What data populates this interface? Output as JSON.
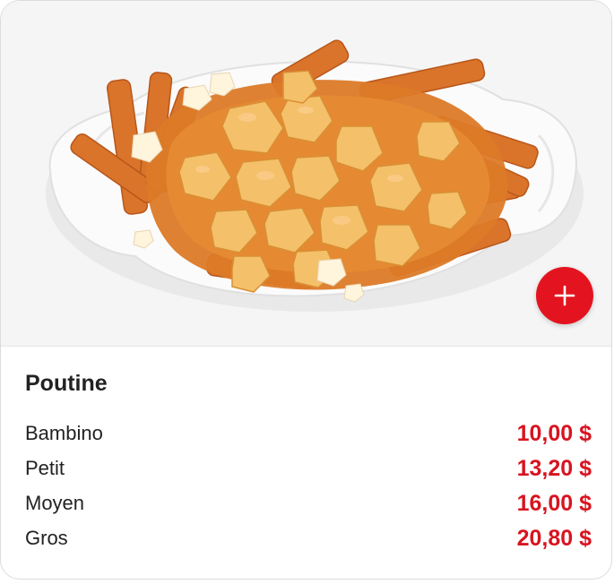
{
  "product": {
    "name": "Poutine",
    "image_alt": "poutine-photo",
    "add_button_icon": "plus-icon",
    "accent_color": "#e3141f",
    "price_color": "#d81420"
  },
  "sizes": [
    {
      "label": "Bambino",
      "price": "10,00 $"
    },
    {
      "label": "Petit",
      "price": "13,20 $"
    },
    {
      "label": "Moyen",
      "price": "16,00 $"
    },
    {
      "label": "Gros",
      "price": "20,80 $"
    }
  ]
}
